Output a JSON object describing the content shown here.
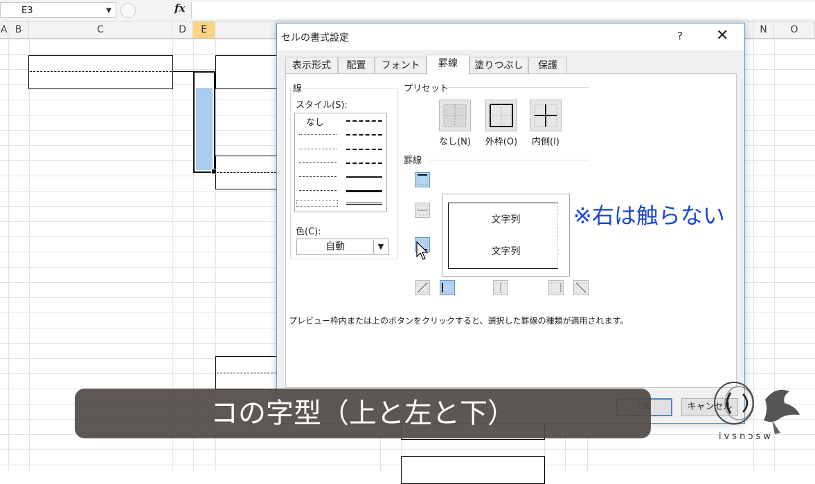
{
  "formula_bar": {
    "name_box": "E3",
    "fx_label": "fx",
    "formula": ""
  },
  "columns": [
    {
      "label": "A",
      "selected": false
    },
    {
      "label": "B",
      "selected": false
    },
    {
      "label": "C",
      "selected": false
    },
    {
      "label": "D",
      "selected": false
    },
    {
      "label": "E",
      "selected": true
    },
    {
      "label": "N",
      "selected": false
    },
    {
      "label": "O",
      "selected": false
    }
  ],
  "dialog": {
    "title": "セルの書式設定",
    "help": "?",
    "close": "✕",
    "tabs": [
      {
        "label": "表示形式",
        "active": false
      },
      {
        "label": "配置",
        "active": false
      },
      {
        "label": "フォント",
        "active": false
      },
      {
        "label": "罫線",
        "active": true
      },
      {
        "label": "塗りつぶし",
        "active": false
      },
      {
        "label": "保護",
        "active": false
      }
    ],
    "line_group_label": "線",
    "style_label": "スタイル(S):",
    "style_none": "なし",
    "color_label": "色(C):",
    "color_value": "自動",
    "preset_label": "プリセット",
    "presets": [
      {
        "label": "なし(N)"
      },
      {
        "label": "外枠(O)"
      },
      {
        "label": "内側(I)"
      }
    ],
    "border_label": "罫線",
    "preview_text_1": "文字列",
    "preview_text_2": "文字列",
    "note": "プレビュー枠内または上のボタンをクリックすると、選択した罫線の種類が適用されます。",
    "ok_label": "OK",
    "cancel_label": "キャンセル"
  },
  "annotation": "※右は触らない",
  "caption": "コの字型（上と左と下）",
  "watermark": "ivsnɔsw",
  "colors": {
    "accent": "#5b9bd5",
    "annotation": "#1a49d0",
    "selected_col": "#fcd382",
    "selection_fill": "#a9cdf0"
  }
}
